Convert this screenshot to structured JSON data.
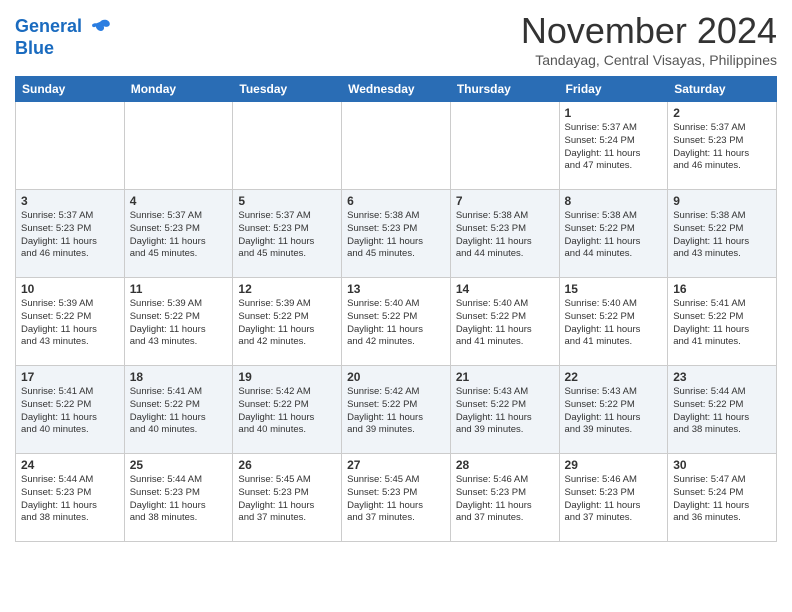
{
  "header": {
    "logo_line1": "General",
    "logo_line2": "Blue",
    "month_title": "November 2024",
    "location": "Tandayag, Central Visayas, Philippines"
  },
  "calendar": {
    "days_of_week": [
      "Sunday",
      "Monday",
      "Tuesday",
      "Wednesday",
      "Thursday",
      "Friday",
      "Saturday"
    ],
    "weeks": [
      [
        {
          "day": "",
          "info": ""
        },
        {
          "day": "",
          "info": ""
        },
        {
          "day": "",
          "info": ""
        },
        {
          "day": "",
          "info": ""
        },
        {
          "day": "",
          "info": ""
        },
        {
          "day": "1",
          "info": "Sunrise: 5:37 AM\nSunset: 5:24 PM\nDaylight: 11 hours\nand 47 minutes."
        },
        {
          "day": "2",
          "info": "Sunrise: 5:37 AM\nSunset: 5:23 PM\nDaylight: 11 hours\nand 46 minutes."
        }
      ],
      [
        {
          "day": "3",
          "info": "Sunrise: 5:37 AM\nSunset: 5:23 PM\nDaylight: 11 hours\nand 46 minutes."
        },
        {
          "day": "4",
          "info": "Sunrise: 5:37 AM\nSunset: 5:23 PM\nDaylight: 11 hours\nand 45 minutes."
        },
        {
          "day": "5",
          "info": "Sunrise: 5:37 AM\nSunset: 5:23 PM\nDaylight: 11 hours\nand 45 minutes."
        },
        {
          "day": "6",
          "info": "Sunrise: 5:38 AM\nSunset: 5:23 PM\nDaylight: 11 hours\nand 45 minutes."
        },
        {
          "day": "7",
          "info": "Sunrise: 5:38 AM\nSunset: 5:23 PM\nDaylight: 11 hours\nand 44 minutes."
        },
        {
          "day": "8",
          "info": "Sunrise: 5:38 AM\nSunset: 5:22 PM\nDaylight: 11 hours\nand 44 minutes."
        },
        {
          "day": "9",
          "info": "Sunrise: 5:38 AM\nSunset: 5:22 PM\nDaylight: 11 hours\nand 43 minutes."
        }
      ],
      [
        {
          "day": "10",
          "info": "Sunrise: 5:39 AM\nSunset: 5:22 PM\nDaylight: 11 hours\nand 43 minutes."
        },
        {
          "day": "11",
          "info": "Sunrise: 5:39 AM\nSunset: 5:22 PM\nDaylight: 11 hours\nand 43 minutes."
        },
        {
          "day": "12",
          "info": "Sunrise: 5:39 AM\nSunset: 5:22 PM\nDaylight: 11 hours\nand 42 minutes."
        },
        {
          "day": "13",
          "info": "Sunrise: 5:40 AM\nSunset: 5:22 PM\nDaylight: 11 hours\nand 42 minutes."
        },
        {
          "day": "14",
          "info": "Sunrise: 5:40 AM\nSunset: 5:22 PM\nDaylight: 11 hours\nand 41 minutes."
        },
        {
          "day": "15",
          "info": "Sunrise: 5:40 AM\nSunset: 5:22 PM\nDaylight: 11 hours\nand 41 minutes."
        },
        {
          "day": "16",
          "info": "Sunrise: 5:41 AM\nSunset: 5:22 PM\nDaylight: 11 hours\nand 41 minutes."
        }
      ],
      [
        {
          "day": "17",
          "info": "Sunrise: 5:41 AM\nSunset: 5:22 PM\nDaylight: 11 hours\nand 40 minutes."
        },
        {
          "day": "18",
          "info": "Sunrise: 5:41 AM\nSunset: 5:22 PM\nDaylight: 11 hours\nand 40 minutes."
        },
        {
          "day": "19",
          "info": "Sunrise: 5:42 AM\nSunset: 5:22 PM\nDaylight: 11 hours\nand 40 minutes."
        },
        {
          "day": "20",
          "info": "Sunrise: 5:42 AM\nSunset: 5:22 PM\nDaylight: 11 hours\nand 39 minutes."
        },
        {
          "day": "21",
          "info": "Sunrise: 5:43 AM\nSunset: 5:22 PM\nDaylight: 11 hours\nand 39 minutes."
        },
        {
          "day": "22",
          "info": "Sunrise: 5:43 AM\nSunset: 5:22 PM\nDaylight: 11 hours\nand 39 minutes."
        },
        {
          "day": "23",
          "info": "Sunrise: 5:44 AM\nSunset: 5:22 PM\nDaylight: 11 hours\nand 38 minutes."
        }
      ],
      [
        {
          "day": "24",
          "info": "Sunrise: 5:44 AM\nSunset: 5:23 PM\nDaylight: 11 hours\nand 38 minutes."
        },
        {
          "day": "25",
          "info": "Sunrise: 5:44 AM\nSunset: 5:23 PM\nDaylight: 11 hours\nand 38 minutes."
        },
        {
          "day": "26",
          "info": "Sunrise: 5:45 AM\nSunset: 5:23 PM\nDaylight: 11 hours\nand 37 minutes."
        },
        {
          "day": "27",
          "info": "Sunrise: 5:45 AM\nSunset: 5:23 PM\nDaylight: 11 hours\nand 37 minutes."
        },
        {
          "day": "28",
          "info": "Sunrise: 5:46 AM\nSunset: 5:23 PM\nDaylight: 11 hours\nand 37 minutes."
        },
        {
          "day": "29",
          "info": "Sunrise: 5:46 AM\nSunset: 5:23 PM\nDaylight: 11 hours\nand 37 minutes."
        },
        {
          "day": "30",
          "info": "Sunrise: 5:47 AM\nSunset: 5:24 PM\nDaylight: 11 hours\nand 36 minutes."
        }
      ]
    ]
  }
}
